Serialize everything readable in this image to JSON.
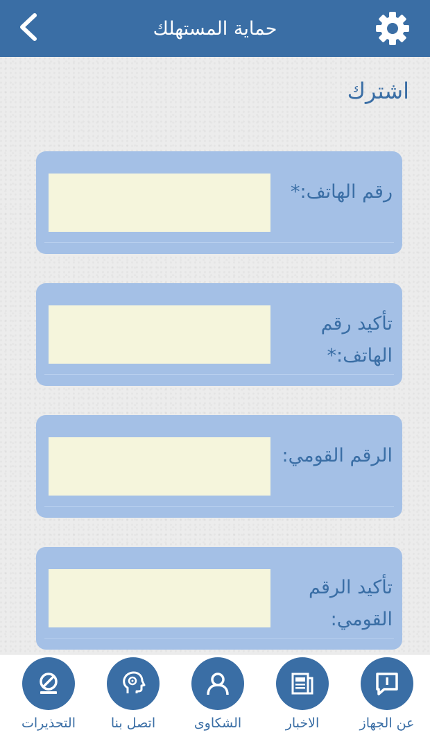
{
  "header": {
    "title": "حماية المستهلك",
    "back_icon": "chevron-left-icon",
    "settings_icon": "gear-icon"
  },
  "page": {
    "section_title": "اشترك"
  },
  "form": {
    "fields": [
      {
        "label": "رقم الهاتف:*",
        "value": ""
      },
      {
        "label": "تأكيد رقم الهاتف:*",
        "value": ""
      },
      {
        "label": "الرقم القومي:",
        "value": ""
      },
      {
        "label": "تأكيد الرقم القومي:",
        "value": ""
      }
    ]
  },
  "nav": {
    "items": [
      {
        "label": "عن الجهاز",
        "icon": "speech-bubble-icon"
      },
      {
        "label": "الاخبار",
        "icon": "newspaper-icon"
      },
      {
        "label": "الشكاوى",
        "icon": "user-icon"
      },
      {
        "label": "اتصل بنا",
        "icon": "head-headset-icon"
      },
      {
        "label": "التحذيرات",
        "icon": "warning-icon"
      }
    ]
  },
  "colors": {
    "primary": "#3a6ea5",
    "card": "#a4c0e6",
    "input": "#f5f5dc"
  }
}
